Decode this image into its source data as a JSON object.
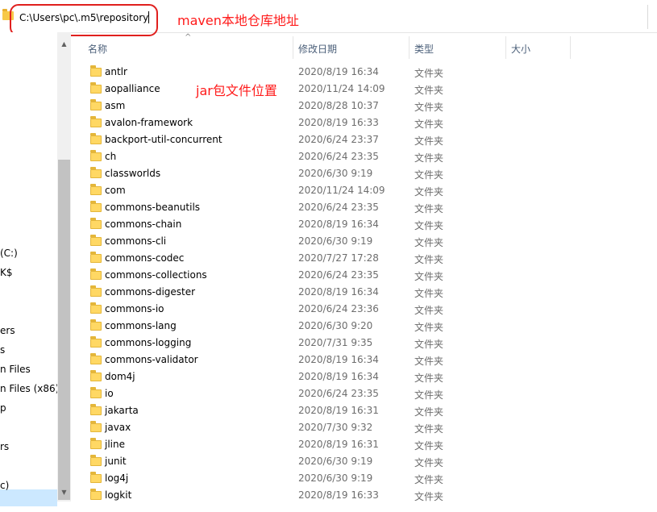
{
  "address_bar": {
    "path": "C:\\Users\\pc\\.m5\\repository"
  },
  "annotations": {
    "maven_note": "maven本地仓库地址",
    "jar_note": "jar包文件位置",
    "color": "#ff1a1a"
  },
  "nav": {
    "items": [
      "(C:)",
      "K$",
      "ers",
      "s",
      "n Files",
      "n Files (x86)",
      "p",
      "rs",
      "c)"
    ]
  },
  "columns": {
    "name": "名称",
    "date": "修改日期",
    "type": "类型",
    "size": "大小"
  },
  "files": [
    {
      "name": "antlr",
      "date": "2020/8/19 16:34",
      "type": "文件夹"
    },
    {
      "name": "aopalliance",
      "date": "2020/11/24 14:09",
      "type": "文件夹"
    },
    {
      "name": "asm",
      "date": "2020/8/28 10:37",
      "type": "文件夹"
    },
    {
      "name": "avalon-framework",
      "date": "2020/8/19 16:33",
      "type": "文件夹"
    },
    {
      "name": "backport-util-concurrent",
      "date": "2020/6/24 23:37",
      "type": "文件夹"
    },
    {
      "name": "ch",
      "date": "2020/6/24 23:35",
      "type": "文件夹"
    },
    {
      "name": "classworlds",
      "date": "2020/6/30 9:19",
      "type": "文件夹"
    },
    {
      "name": "com",
      "date": "2020/11/24 14:09",
      "type": "文件夹"
    },
    {
      "name": "commons-beanutils",
      "date": "2020/6/24 23:35",
      "type": "文件夹"
    },
    {
      "name": "commons-chain",
      "date": "2020/8/19 16:34",
      "type": "文件夹"
    },
    {
      "name": "commons-cli",
      "date": "2020/6/30 9:19",
      "type": "文件夹"
    },
    {
      "name": "commons-codec",
      "date": "2020/7/27 17:28",
      "type": "文件夹"
    },
    {
      "name": "commons-collections",
      "date": "2020/6/24 23:35",
      "type": "文件夹"
    },
    {
      "name": "commons-digester",
      "date": "2020/8/19 16:34",
      "type": "文件夹"
    },
    {
      "name": "commons-io",
      "date": "2020/6/24 23:36",
      "type": "文件夹"
    },
    {
      "name": "commons-lang",
      "date": "2020/6/30 9:20",
      "type": "文件夹"
    },
    {
      "name": "commons-logging",
      "date": "2020/7/31 9:35",
      "type": "文件夹"
    },
    {
      "name": "commons-validator",
      "date": "2020/8/19 16:34",
      "type": "文件夹"
    },
    {
      "name": "dom4j",
      "date": "2020/8/19 16:34",
      "type": "文件夹"
    },
    {
      "name": "io",
      "date": "2020/6/24 23:35",
      "type": "文件夹"
    },
    {
      "name": "jakarta",
      "date": "2020/8/19 16:31",
      "type": "文件夹"
    },
    {
      "name": "javax",
      "date": "2020/7/30 9:32",
      "type": "文件夹"
    },
    {
      "name": "jline",
      "date": "2020/8/19 16:31",
      "type": "文件夹"
    },
    {
      "name": "junit",
      "date": "2020/6/30 9:19",
      "type": "文件夹"
    },
    {
      "name": "log4j",
      "date": "2020/6/30 9:19",
      "type": "文件夹"
    },
    {
      "name": "logkit",
      "date": "2020/8/19 16:33",
      "type": "文件夹"
    }
  ]
}
